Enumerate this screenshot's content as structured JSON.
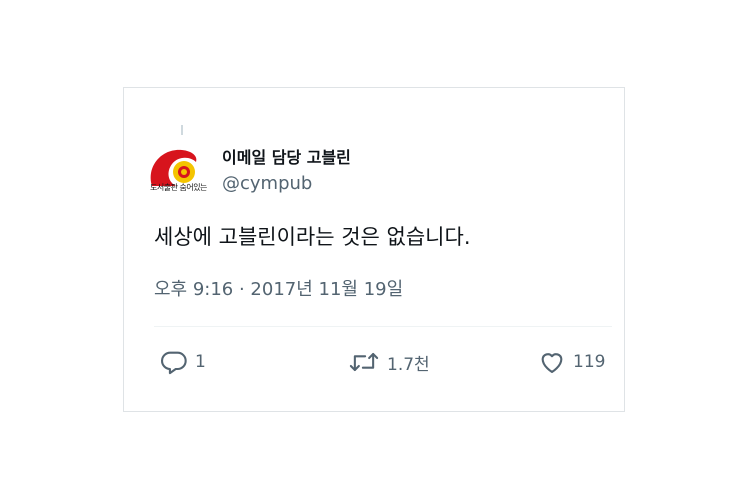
{
  "tweet": {
    "author_name": "이메일 담당 고블린",
    "author_handle": "@cympub",
    "avatar_caption": "도서출판 숨어있는",
    "text": "세상에 고블린이라는 것은 없습니다.",
    "timestamp": "오후 9:16 · 2017년 11월 19일"
  },
  "actions": {
    "reply_count": "1",
    "retweet_count": "1.7천",
    "like_count": "119"
  },
  "icons": {
    "reply": "reply-icon",
    "retweet": "retweet-icon",
    "like": "heart-icon"
  },
  "colors": {
    "text_primary": "#0f1419",
    "text_secondary": "#536471",
    "avatar_red": "#d7141d",
    "avatar_yellow": "#f4c400"
  }
}
